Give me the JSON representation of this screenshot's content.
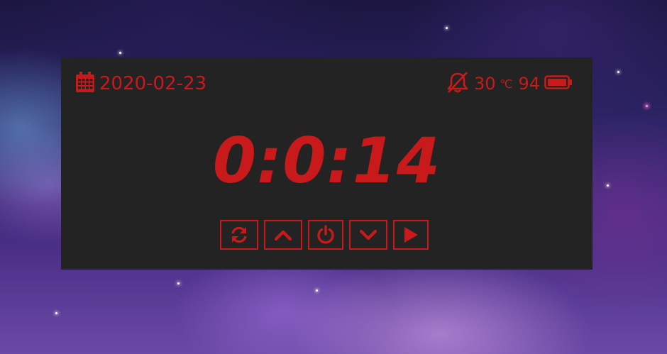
{
  "window": {
    "date": "2020-02-23",
    "temperature": "30",
    "temperature_unit": "℃",
    "battery_level": "94",
    "time": "0:0:14"
  },
  "icons": {
    "calendar": "calendar-icon",
    "alarm_off": "bell-slash-icon",
    "battery": "battery-full-icon"
  },
  "controls": [
    {
      "name": "reset-button",
      "icon": "refresh-icon"
    },
    {
      "name": "up-button",
      "icon": "chevron-up-icon"
    },
    {
      "name": "power-button",
      "icon": "power-icon"
    },
    {
      "name": "down-button",
      "icon": "chevron-down-icon"
    },
    {
      "name": "play-button",
      "icon": "play-icon"
    }
  ],
  "colors": {
    "accent": "#c81a1a",
    "panel_bg": "#232323"
  }
}
